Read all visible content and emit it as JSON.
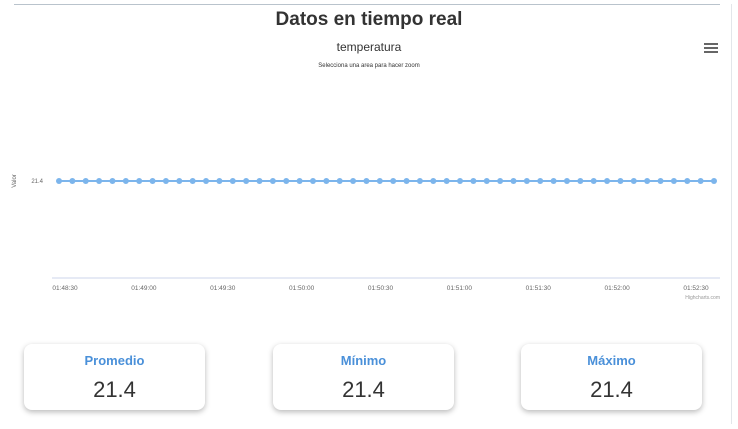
{
  "page": {
    "title": "Datos en tiempo real"
  },
  "chart_data": {
    "type": "line",
    "title": "temperatura",
    "subtitle": "Selecciona una area para hacer zoom",
    "ylabel": "Valor",
    "xlabel": "",
    "credits": "Highcharts.com",
    "y_tick_labels": [
      "21.4"
    ],
    "x_tick_labels": [
      "01:48:30",
      "01:49:00",
      "01:49:30",
      "01:50:00",
      "01:50:30",
      "01:51:00",
      "01:51:30",
      "01:52:00",
      "01:52:30"
    ],
    "series": [
      {
        "color": "#7cb5ec",
        "values": [
          21.4,
          21.4,
          21.4,
          21.4,
          21.4,
          21.4,
          21.4,
          21.4,
          21.4,
          21.4,
          21.4,
          21.4,
          21.4,
          21.4,
          21.4,
          21.4,
          21.4,
          21.4,
          21.4,
          21.4,
          21.4,
          21.4,
          21.4,
          21.4,
          21.4,
          21.4,
          21.4,
          21.4,
          21.4,
          21.4,
          21.4,
          21.4,
          21.4,
          21.4,
          21.4,
          21.4,
          21.4,
          21.4,
          21.4,
          21.4,
          21.4,
          21.4,
          21.4,
          21.4,
          21.4,
          21.4,
          21.4,
          21.4,
          21.4,
          21.4
        ]
      }
    ],
    "grid": false,
    "legend": "none"
  },
  "menu": {
    "icon": "hamburger-menu-icon"
  },
  "stats": [
    {
      "label": "Promedio",
      "value": "21.4"
    },
    {
      "label": "Mínimo",
      "value": "21.4"
    },
    {
      "label": "Máximo",
      "value": "21.4"
    }
  ],
  "colors": {
    "accent": "#4a90d9",
    "series": "#7cb5ec"
  }
}
